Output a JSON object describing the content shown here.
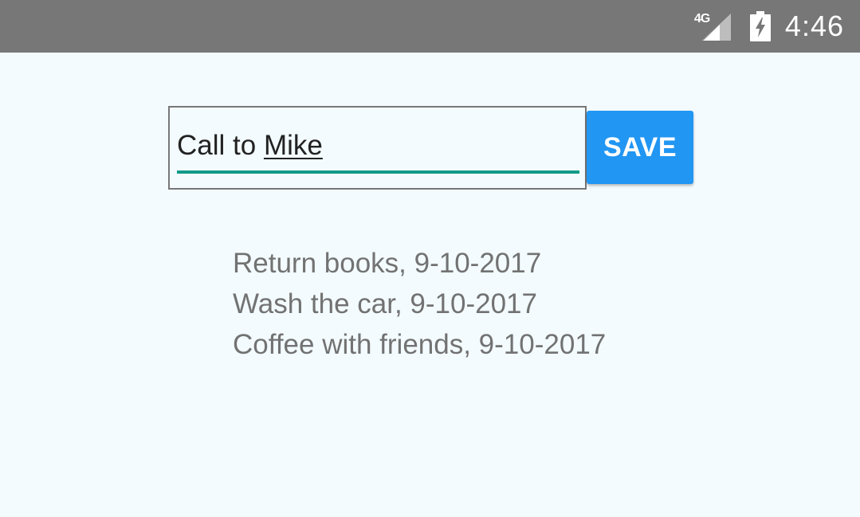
{
  "status_bar": {
    "network_label": "4G",
    "network_icon": "signal-icon",
    "battery_icon": "battery-charging-icon",
    "time": "4:46",
    "background_color": "#777777"
  },
  "task_input": {
    "value_prefix": "Call to ",
    "value_underlined": "Mike",
    "focus_color": "#119a8a"
  },
  "save_button": {
    "label": "SAVE",
    "color": "#2196f3"
  },
  "tasks": [
    "Return books, 9-10-2017",
    "Wash the car, 9-10-2017",
    "Coffee with friends, 9-10-2017"
  ]
}
